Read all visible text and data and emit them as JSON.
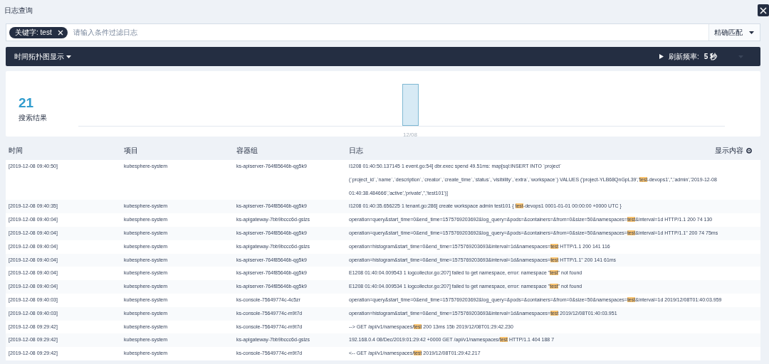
{
  "window": {
    "title": "日志查询"
  },
  "search": {
    "tag": {
      "label": "关键字: test"
    },
    "placeholder": "请输入条件过滤日志",
    "match_mode": "精确匹配"
  },
  "toolbar": {
    "view_toggle": "时间拓扑图显示",
    "refresh_label": "刷新频率:",
    "refresh_value": "5 秒"
  },
  "summary": {
    "count": "21",
    "label": "搜索结果",
    "histogram_label": "12/08"
  },
  "table": {
    "columns": [
      "时间",
      "项目",
      "容器组",
      "日志"
    ],
    "settings_label": "显示内容",
    "rows": [
      {
        "time": "[2019-12-08 09:40:50]",
        "project": "kubesphere-system",
        "pod": "ks-apiserver-764f85646b-qg5k9",
        "log": [
          [
            {
              "text": "I1208 01:40:50.137145 1 event.go:54] dbr.exec spend 49.51ms: map[sql:INSERT INTO `project`",
              "highlighted": false
            }
          ],
          [
            {
              "text": "(`project_id`,`name`,`description`,`creator`,`create_time`,`status`,`visibility`,`extra`,`workspace`) VALUES ('project-YLB68QnGpL39','",
              "highlighted": false
            },
            {
              "text": "test",
              "highlighted": true
            },
            {
              "text": "-devops1','','admin','2019-12-08",
              "highlighted": false
            }
          ],
          [
            {
              "text": "01:40:38.484666','active','private','','test101')]",
              "highlighted": false
            }
          ]
        ]
      },
      {
        "time": "[2019-12-08 09:40:35]",
        "project": "kubesphere-system",
        "pod": "ks-apiserver-764f85646b-qg5k9",
        "log": [
          [
            {
              "text": "I1208 01:40:35.656225 1 tenant.go:286] create workspace admin test101 { ",
              "highlighted": false
            },
            {
              "text": "test",
              "highlighted": true
            },
            {
              "text": "-devops1 0001-01-01 00:00:00 +0000 UTC }",
              "highlighted": false
            }
          ]
        ]
      },
      {
        "time": "[2019-12-08 09:40:04]",
        "project": "kubesphere-system",
        "pod": "ks-apigateway-7bb9bccc6d-gslzs",
        "log": [
          [
            {
              "text": "operation=query&start_time=0&end_time=1575769203692&log_query=&pods=&containers=&from=0&size=50&namespaces=",
              "highlighted": false
            },
            {
              "text": "test",
              "highlighted": true
            },
            {
              "text": "&interval=1d HTTP/1.1 200 74 130",
              "highlighted": false
            }
          ]
        ]
      },
      {
        "time": "[2019-12-08 09:40:04]",
        "project": "kubesphere-system",
        "pod": "ks-apiserver-764f85646b-qg5k9",
        "log": [
          [
            {
              "text": "operation=query&start_time=0&end_time=1575769203692&log_query=&pods=&containers=&from=0&size=50&namespaces=",
              "highlighted": false
            },
            {
              "text": "test",
              "highlighted": true
            },
            {
              "text": "&interval=1d HTTP/1.1\" 200 74 75ms",
              "highlighted": false
            }
          ]
        ]
      },
      {
        "time": "[2019-12-08 09:40:04]",
        "project": "kubesphere-system",
        "pod": "ks-apigateway-7bb9bccc6d-gslzs",
        "log": [
          [
            {
              "text": "operation=histogram&start_time=0&end_time=1575769203693&interval=1d&namespaces=",
              "highlighted": false
            },
            {
              "text": "test",
              "highlighted": true
            },
            {
              "text": " HTTP/1.1 200 141 116",
              "highlighted": false
            }
          ]
        ]
      },
      {
        "time": "[2019-12-08 09:40:04]",
        "project": "kubesphere-system",
        "pod": "ks-apiserver-764f85646b-qg5k9",
        "log": [
          [
            {
              "text": "operation=histogram&start_time=0&end_time=1575769203693&interval=1d&namespaces=",
              "highlighted": false
            },
            {
              "text": "test",
              "highlighted": true
            },
            {
              "text": " HTTP/1.1\" 200 141 61ms",
              "highlighted": false
            }
          ]
        ]
      },
      {
        "time": "[2019-12-08 09:40:04]",
        "project": "kubesphere-system",
        "pod": "ks-apiserver-764f85646b-qg5k9",
        "log": [
          [
            {
              "text": "E1208 01:40:04.009543 1 logcollector.go:207] failed to get namespace, error: namespace \"",
              "highlighted": false
            },
            {
              "text": "test",
              "highlighted": true
            },
            {
              "text": "\" not found",
              "highlighted": false
            }
          ]
        ]
      },
      {
        "time": "[2019-12-08 09:40:04]",
        "project": "kubesphere-system",
        "pod": "ks-apiserver-764f85646b-qg5k9",
        "log": [
          [
            {
              "text": "E1208 01:40:04.009534 1 logcollector.go:207] failed to get namespace, error: namespace \"",
              "highlighted": false
            },
            {
              "text": "test",
              "highlighted": true
            },
            {
              "text": "\" not found",
              "highlighted": false
            }
          ]
        ]
      },
      {
        "time": "[2019-12-08 09:40:03]",
        "project": "kubesphere-system",
        "pod": "ks-console-75649774c-4c5zr",
        "log": [
          [
            {
              "text": "operation=query&start_time=0&end_time=1575769203692&log_query=&pods=&containers=&from=0&size=50&namespaces=",
              "highlighted": false
            },
            {
              "text": "test",
              "highlighted": true
            },
            {
              "text": "&interval=1d 2019/12/08T01:40:03.959",
              "highlighted": false
            }
          ]
        ]
      },
      {
        "time": "[2019-12-08 09:40:03]",
        "project": "kubesphere-system",
        "pod": "ks-console-75649774c-m9t7d",
        "log": [
          [
            {
              "text": "operation=histogram&start_time=0&end_time=1575769203693&interval=1d&namespaces=",
              "highlighted": false
            },
            {
              "text": "test",
              "highlighted": true
            },
            {
              "text": " 2019/12/08T01:40:03.951",
              "highlighted": false
            }
          ]
        ]
      },
      {
        "time": "[2019-12-08 09:29:42]",
        "project": "kubesphere-system",
        "pod": "ks-console-75649774c-m9t7d",
        "log": [
          [
            {
              "text": "--> GET /api/v1/namespaces/",
              "highlighted": false
            },
            {
              "text": "test",
              "highlighted": true
            },
            {
              "text": " 200 13ms 15b 2019/12/08T01:29:42.230",
              "highlighted": false
            }
          ]
        ]
      },
      {
        "time": "[2019-12-08 09:29:42]",
        "project": "kubesphere-system",
        "pod": "ks-apigateway-7bb9bccc6d-gslzs",
        "log": [
          [
            {
              "text": "192.168.0.4 08/Dec/2019:01:29:42 +0000 GET /api/v1/namespaces/",
              "highlighted": false
            },
            {
              "text": "test",
              "highlighted": true
            },
            {
              "text": " HTTP/1.1 404 188 7",
              "highlighted": false
            }
          ]
        ]
      },
      {
        "time": "[2019-12-08 09:29:42]",
        "project": "kubesphere-system",
        "pod": "ks-console-75649774c-m9t7d",
        "log": [
          [
            {
              "text": "<-- GET /api/v1/namespaces/",
              "highlighted": false
            },
            {
              "text": "test",
              "highlighted": true
            },
            {
              "text": " 2019/12/08T01:29:42.217",
              "highlighted": false
            }
          ]
        ]
      }
    ]
  }
}
